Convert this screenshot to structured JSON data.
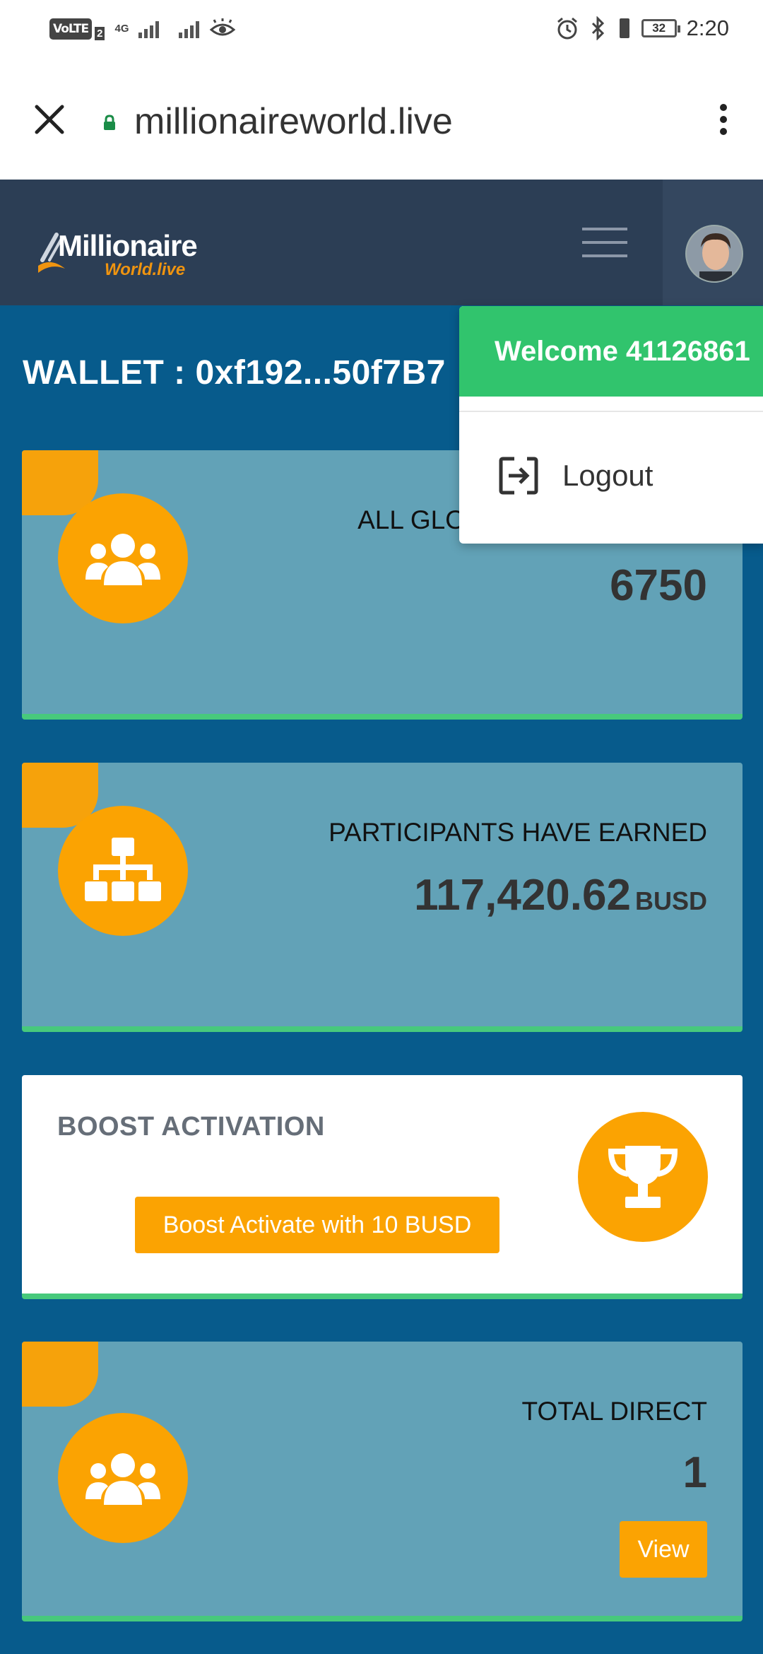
{
  "status_bar": {
    "volte": "VoLTE",
    "sim": "2",
    "network": "4G",
    "battery": "32",
    "time": "2:20"
  },
  "browser": {
    "url": "millionaireworld.live"
  },
  "site": {
    "logo_main": "Millionaire",
    "logo_sub": "World.live"
  },
  "dropdown": {
    "welcome": "Welcome 41126861",
    "logout": "Logout"
  },
  "wallet": {
    "label": "WALLET : 0xf192...50f7B7"
  },
  "cards": {
    "global": {
      "title": "ALL GLOBAL PARTICIPANTS",
      "value": "6750",
      "icon": "users-icon"
    },
    "earned": {
      "title": "PARTICIPANTS HAVE EARNED",
      "value": "117,420.62",
      "unit": "BUSD",
      "icon": "sitemap-icon"
    },
    "boost": {
      "title": "BOOST ACTIVATION",
      "button": "Boost Activate with 10 BUSD",
      "icon": "trophy-icon"
    },
    "direct": {
      "title": "TOTAL DIRECT",
      "value": "1",
      "button": "View",
      "icon": "users-icon"
    }
  },
  "colors": {
    "background": "#075b8c",
    "nav": "#2c3e55",
    "card": "#62a2b7",
    "accent_orange": "#fba302",
    "accent_green": "#47c97c",
    "welcome_green": "#31c46d"
  }
}
